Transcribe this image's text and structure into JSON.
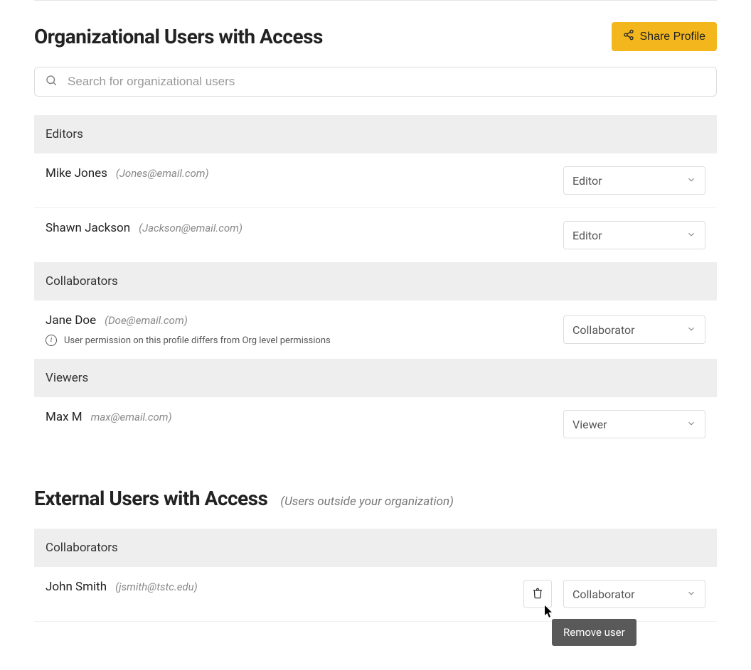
{
  "header": {
    "title": "Organizational Users with Access",
    "share_label": "Share Profile"
  },
  "search": {
    "placeholder": "Search for organizational users"
  },
  "warning_text": "User permission on this profile differs from Org level permissions",
  "org_groups": [
    {
      "label": "Editors",
      "users": [
        {
          "name": "Mike Jones",
          "email": "(Jones@email.com)",
          "role": "Editor"
        },
        {
          "name": "Shawn Jackson",
          "email": "(Jackson@email.com)",
          "role": "Editor"
        }
      ]
    },
    {
      "label": "Collaborators",
      "users": [
        {
          "name": "Jane Doe",
          "email": "(Doe@email.com)",
          "role": "Collaborator",
          "warning": true
        }
      ]
    },
    {
      "label": "Viewers",
      "users": [
        {
          "name": "Max M",
          "email": "max@email.com)",
          "role": "Viewer"
        }
      ]
    }
  ],
  "external": {
    "title": "External Users with Access",
    "subtitle": "(Users outside your organization)",
    "group_label": "Collaborators",
    "user": {
      "name": "John Smith",
      "email": "(jsmith@tstc.edu)",
      "role": "Collaborator"
    },
    "tooltip": "Remove user"
  }
}
